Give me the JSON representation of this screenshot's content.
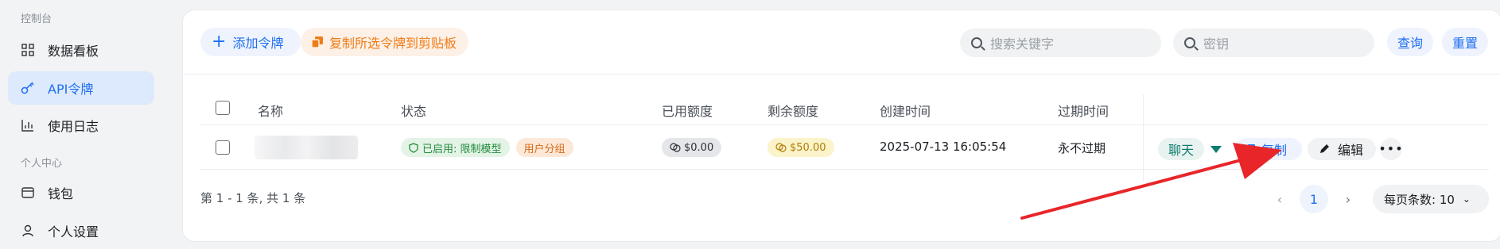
{
  "sidebar": {
    "section_console": "控制台",
    "section_personal": "个人中心",
    "items": [
      {
        "label": "数据看板",
        "icon": "grid-icon"
      },
      {
        "label": "API令牌",
        "icon": "key-icon"
      },
      {
        "label": "使用日志",
        "icon": "chart-icon"
      },
      {
        "label": "钱包",
        "icon": "wallet-icon"
      },
      {
        "label": "个人设置",
        "icon": "user-icon"
      }
    ]
  },
  "toolbar": {
    "add_label": "添加令牌",
    "copy_selected_label": "复制所选令牌到剪贴板",
    "search_keyword_placeholder": "搜索关键字",
    "search_key_placeholder": "密钥",
    "query_label": "查询",
    "reset_label": "重置"
  },
  "table": {
    "headers": [
      "名称",
      "状态",
      "已用额度",
      "剩余额度",
      "创建时间",
      "过期时间"
    ],
    "rows": [
      {
        "status": "已启用: 限制模型",
        "group": "用户分组",
        "used": "$0.00",
        "remaining": "$50.00",
        "created": "2025-07-13 16:05:54",
        "expires": "永不过期",
        "chat_label": "聊天",
        "copy_label": "复制",
        "edit_label": "编辑"
      }
    ]
  },
  "pagination": {
    "summary": "第 1 - 1 条, 共 1 条",
    "current_page": "1",
    "page_size_label": "每页条数: 10"
  },
  "colors": {
    "accent": "#1f6ff0",
    "orange": "#f07c16",
    "arrow": "#e8262a",
    "teal": "#0d7d6e"
  }
}
